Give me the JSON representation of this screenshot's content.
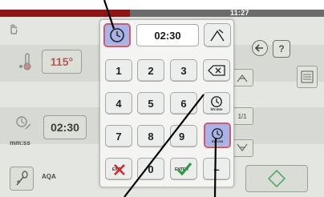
{
  "status": {
    "time": "11:27"
  },
  "background": {
    "temp_value": "115°",
    "timer_value": "02:30",
    "timer_unit": "mm:ss",
    "aqa_label": "AQA",
    "fraction_label": "1/1"
  },
  "keypad": {
    "display_value": "02:30",
    "keys": [
      "1",
      "2",
      "3",
      "4",
      "5",
      "6",
      "7",
      "8",
      "9",
      "0"
    ],
    "hhmm_label": "hh:mm",
    "mmss_label": "mm:ss",
    "exit_label": "EXIT",
    "enter_label": "ENTER",
    "minus_label": "–"
  },
  "colors": {
    "accent_selected": "#a9b3e8",
    "selected_border": "#cf5a78",
    "header_red": "#9a1a1a",
    "confirm_green": "#2a9a3a",
    "cancel_red": "#d22a2a"
  }
}
